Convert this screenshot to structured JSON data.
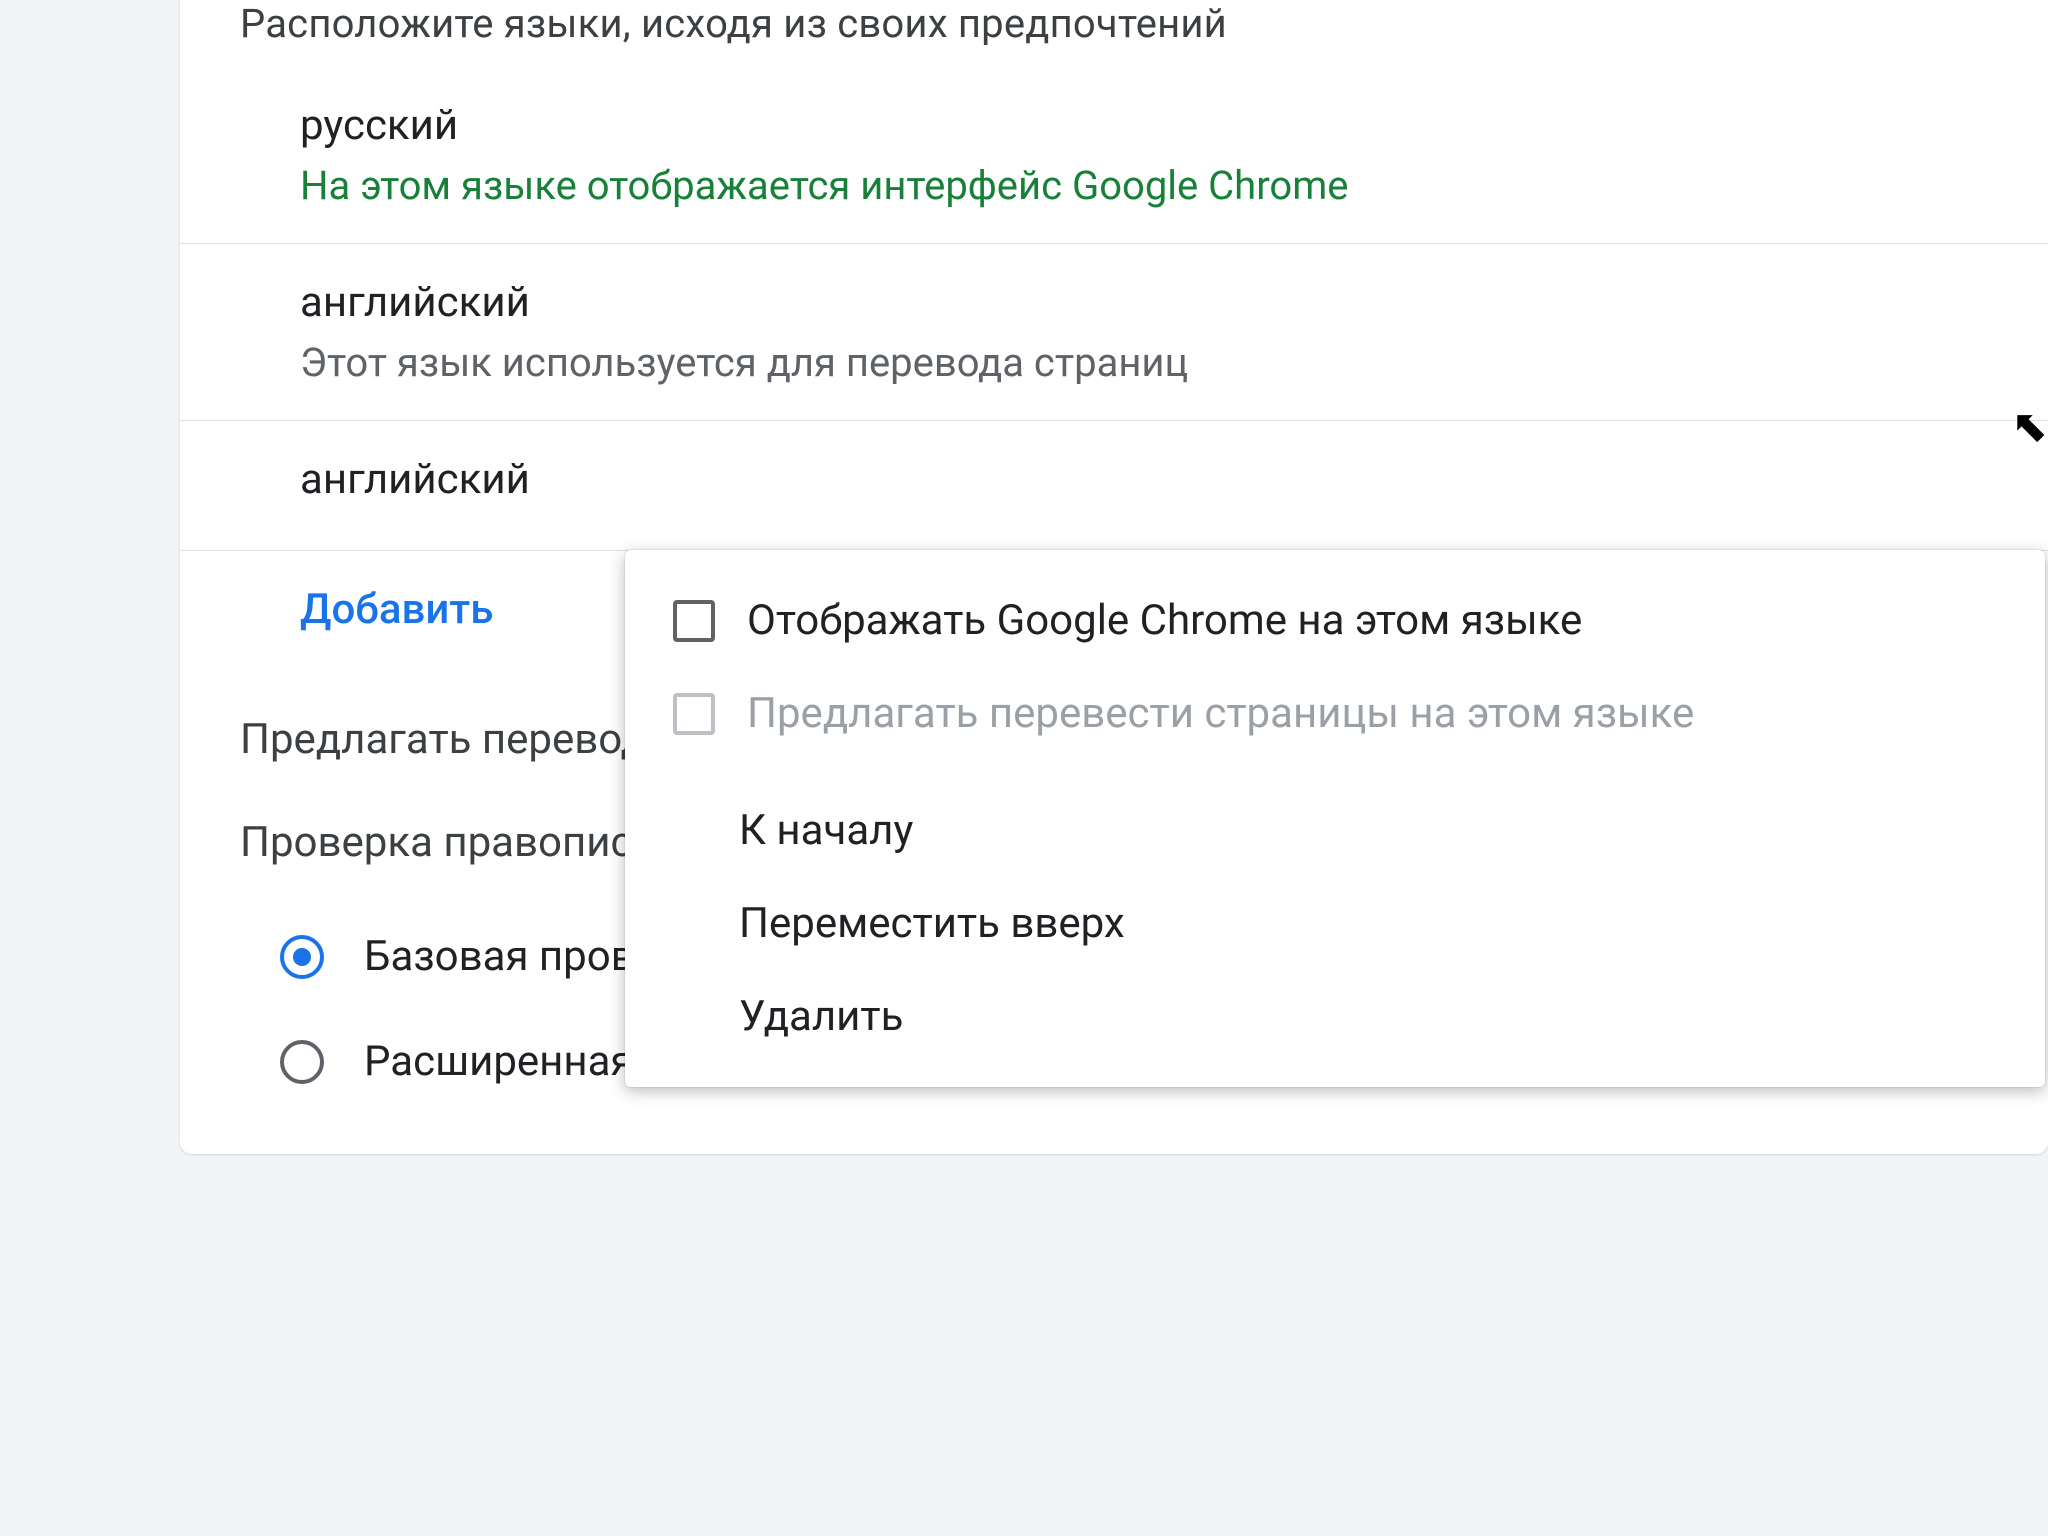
{
  "header": "Расположите языки, исходя из своих предпочтений",
  "languages": [
    {
      "name": "русский",
      "sub": "На этом языке отображается интерфейс Google Chrome",
      "green": true
    },
    {
      "name": "английский",
      "sub": "Этот язык используется для перевода страниц",
      "green": false
    },
    {
      "name": "английский",
      "sub": "",
      "green": false
    }
  ],
  "add_label": "Добавить",
  "offer_translate": "Предлагать перевод страниц на используемом языке",
  "spellcheck_title": "Проверка правописания",
  "spellcheck": {
    "basic": "Базовая проверка правописания",
    "advanced": "Расширенная проверка правописания"
  },
  "menu": {
    "display_chrome": "Отображать Google Chrome на этом языке",
    "offer_translate_lang": "Предлагать перевести страницы на этом языке",
    "to_top": "К началу",
    "move_up": "Переместить вверх",
    "remove": "Удалить"
  }
}
